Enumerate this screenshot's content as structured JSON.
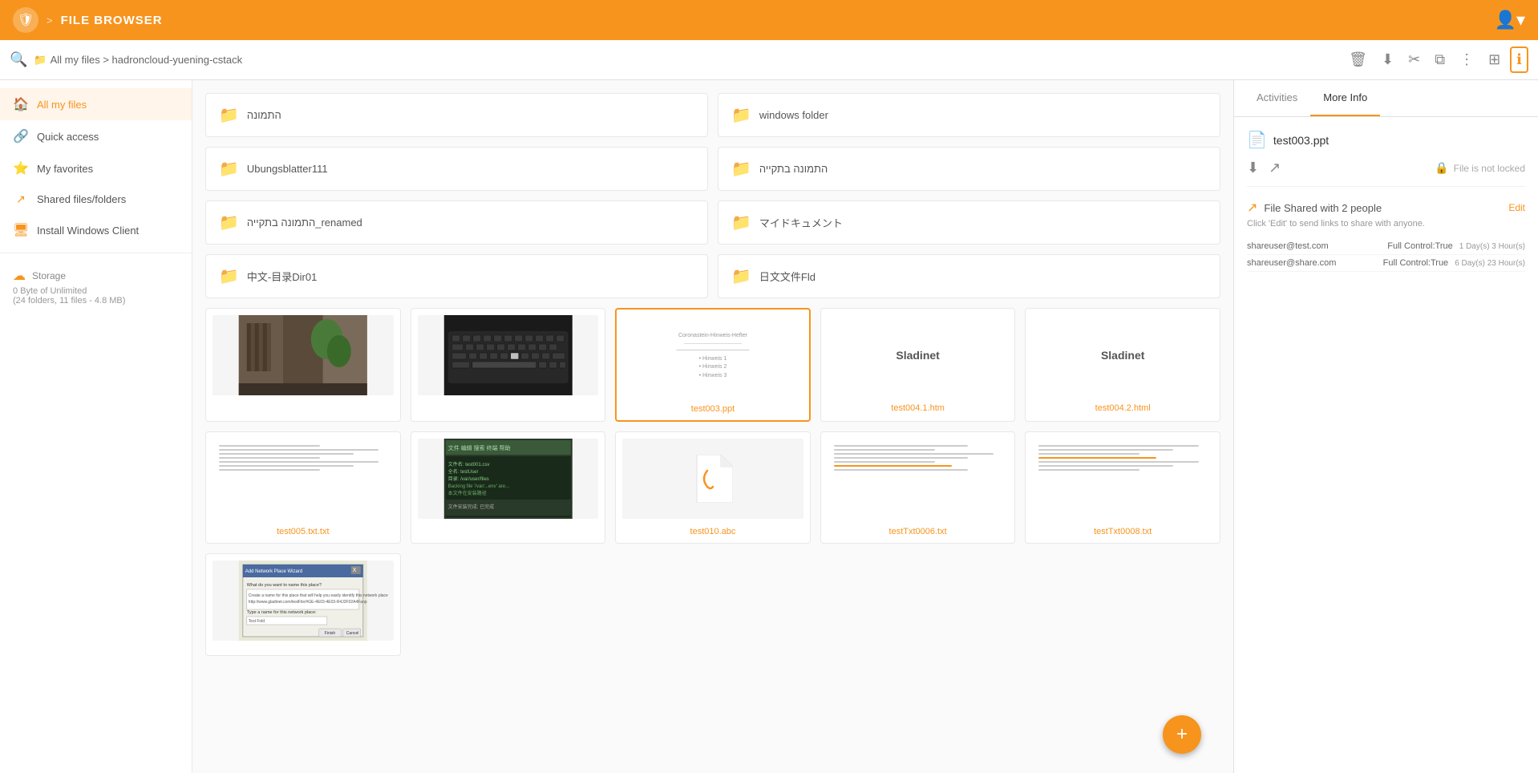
{
  "header": {
    "logo_symbol": "🛡",
    "breadcrumb_separator": ">",
    "app_title": "FILE BROWSER",
    "path_icon": "📁",
    "path_text": "All my files > hadroncloud-yuening-cstack"
  },
  "toolbar": {
    "delete_label": "🗑",
    "download_label": "⬇",
    "cut_label": "✂",
    "copy_label": "⧉",
    "more_label": "⋮",
    "grid_label": "⊞",
    "info_label": "ℹ"
  },
  "sidebar": {
    "items": [
      {
        "id": "all-my-files",
        "icon": "🏠",
        "label": "All my files",
        "active": true
      },
      {
        "id": "quick-access",
        "icon": "🔗",
        "label": "Quick access",
        "active": false
      },
      {
        "id": "my-favorites",
        "icon": "⭐",
        "label": "My favorites",
        "active": false
      },
      {
        "id": "shared-files",
        "icon": "↗",
        "label": "Shared files/folders",
        "active": false
      },
      {
        "id": "install-windows",
        "icon": "🖥",
        "label": "Install Windows Client",
        "active": false
      }
    ],
    "storage": {
      "icon": "☁",
      "label": "Storage",
      "detail": "0 Byte of Unlimited",
      "count": "(24 folders, 11 files - 4.8 MB)"
    }
  },
  "folders": [
    {
      "name": "התמונה"
    },
    {
      "name": "windows folder"
    },
    {
      "name": "Ubungsblatter111"
    },
    {
      "name": "התמונה בתקייה"
    },
    {
      "name": "התמונה בתקייה_renamed"
    },
    {
      "name": "マイドキュメント"
    },
    {
      "name": "中文-目录Dir01"
    },
    {
      "name": "日文文件Fld"
    }
  ],
  "files": [
    {
      "id": "img1",
      "name": "",
      "type": "image",
      "thumb_bg": "#3a3a3a",
      "selected": false
    },
    {
      "id": "img2",
      "name": "",
      "type": "image",
      "thumb_bg": "#222",
      "selected": false
    },
    {
      "id": "test003",
      "name": "test003.ppt",
      "type": "ppt",
      "selected": true
    },
    {
      "id": "test004_1",
      "name": "test004.1.htm",
      "type": "html",
      "selected": false
    },
    {
      "id": "test004_2",
      "name": "test004.2.html",
      "type": "html",
      "selected": false
    },
    {
      "id": "test005",
      "name": "test005.txt.txt",
      "type": "text",
      "selected": false
    },
    {
      "id": "img3",
      "name": "",
      "type": "image_screenshot",
      "thumb_bg": "#2a4a2a",
      "selected": false
    },
    {
      "id": "test010",
      "name": "test010.abc",
      "type": "file_generic",
      "selected": false
    },
    {
      "id": "testTxt0006",
      "name": "testTxt0006.txt",
      "type": "text2",
      "selected": false
    },
    {
      "id": "testTxt0008",
      "name": "testTxt0008.txt",
      "type": "text3",
      "selected": false
    },
    {
      "id": "img4",
      "name": "",
      "type": "image_wizard",
      "thumb_bg": "#e8e8c8",
      "selected": false
    }
  ],
  "right_panel": {
    "tabs": [
      {
        "id": "activities",
        "label": "Activities",
        "active": false
      },
      {
        "id": "more-info",
        "label": "More Info",
        "active": true
      }
    ],
    "file_name": "test003.ppt",
    "lock_status": "File is not locked",
    "share_title": "File Shared with 2 people",
    "share_edit_label": "Edit",
    "share_hint": "Click 'Edit' to send links to share with anyone.",
    "shares": [
      {
        "email": "shareuser@test.com",
        "permission": "Full Control:True",
        "time": "1 Day(s) 3 Hour(s)"
      },
      {
        "email": "shareuser@share.com",
        "permission": "Full Control:True",
        "time": "6 Day(s) 23 Hour(s)"
      }
    ]
  },
  "fab": {
    "icon": "+"
  }
}
